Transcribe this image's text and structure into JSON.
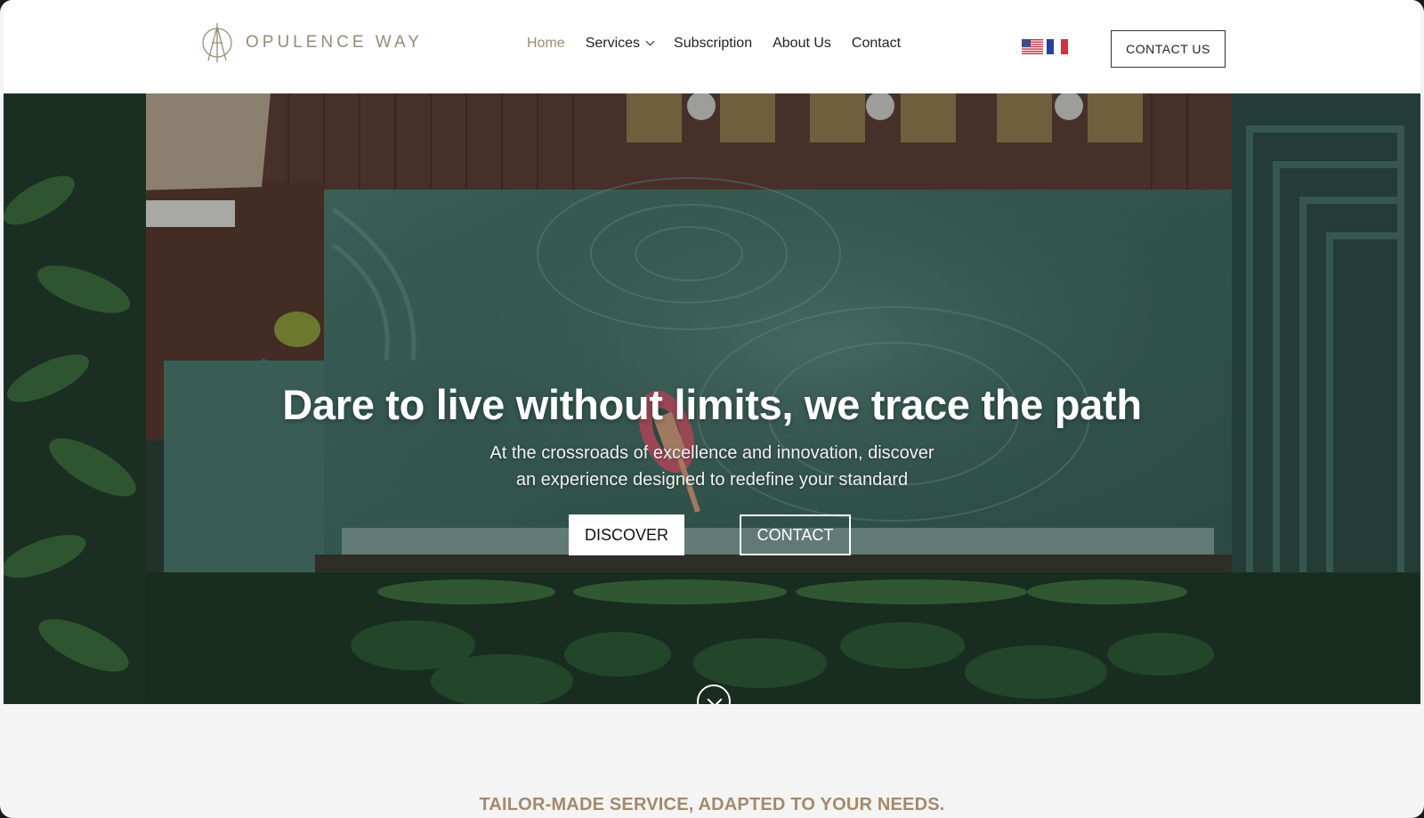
{
  "brand": {
    "name": "OPULENCE WAY"
  },
  "nav": {
    "items": [
      {
        "label": "Home",
        "active": true
      },
      {
        "label": "Services",
        "has_dropdown": true
      },
      {
        "label": "Subscription"
      },
      {
        "label": "About Us"
      },
      {
        "label": "Contact"
      }
    ]
  },
  "languages": [
    {
      "icon": "us-flag-icon",
      "label": "English"
    },
    {
      "icon": "fr-flag-icon",
      "label": "Français"
    }
  ],
  "header": {
    "cta_label": "CONTACT US"
  },
  "hero": {
    "title": "Dare to live without limits, we trace the path",
    "subtitle_line1": "At the crossroads of excellence and innovation, discover",
    "subtitle_line2": "an experience designed to redefine your standard",
    "primary_button": "DISCOVER",
    "secondary_button": "CONTACT",
    "scroll_icon": "chevron-down-circle-icon"
  },
  "section": {
    "tagline": "TAILOR-MADE SERVICE, ADAPTED TO YOUR NEEDS."
  },
  "colors": {
    "accent": "#a38a6d",
    "text": "#222222",
    "white": "#ffffff"
  }
}
